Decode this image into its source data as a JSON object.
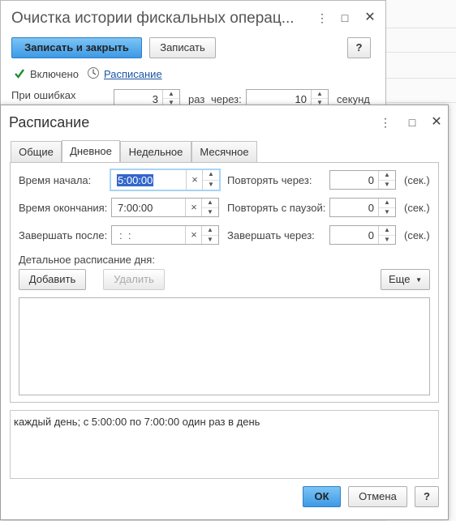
{
  "bg_window": {
    "title": "Очистка истории фискальных операц...",
    "save_close_label": "Записать и закрыть",
    "save_label": "Записать",
    "help_label": "?",
    "enabled_label": "Включено",
    "schedule_link": "Расписание",
    "on_errors_label": "При ошибках",
    "retry_count": "3",
    "times_label": "раз",
    "through_label": "через:",
    "retry_interval": "10",
    "seconds_label": "секунд"
  },
  "dialog": {
    "title": "Расписание",
    "tabs": [
      {
        "label": "Общие"
      },
      {
        "label": "Дневное"
      },
      {
        "label": "Недельное"
      },
      {
        "label": "Месячное"
      }
    ],
    "start_label": "Время начала:",
    "start_value": "5:00:00",
    "end_label": "Время окончания:",
    "end_value": "7:00:00",
    "finish_after_label": "Завершать после:",
    "finish_after_value": ":  :",
    "repeat_every_label": "Повторять через:",
    "repeat_every_value": "0",
    "repeat_pause_label": "Повторять с паузой:",
    "repeat_pause_value": "0",
    "finish_in_label": "Завершать через:",
    "finish_in_value": "0",
    "sec_unit": "(сек.)",
    "clear_glyph": "×",
    "detail_label": "Детальное расписание дня:",
    "add_label": "Добавить",
    "delete_label": "Удалить",
    "more_label": "Еще",
    "summary": "каждый день; с 5:00:00 по 7:00:00 один раз в день",
    "ok_label": "ОК",
    "cancel_label": "Отмена",
    "help_label": "?"
  },
  "colors": {
    "primary_button": "#3d9ae6",
    "link": "#1a55a5",
    "checkbox": "#1f8f2f",
    "selection": "#3366cc"
  }
}
